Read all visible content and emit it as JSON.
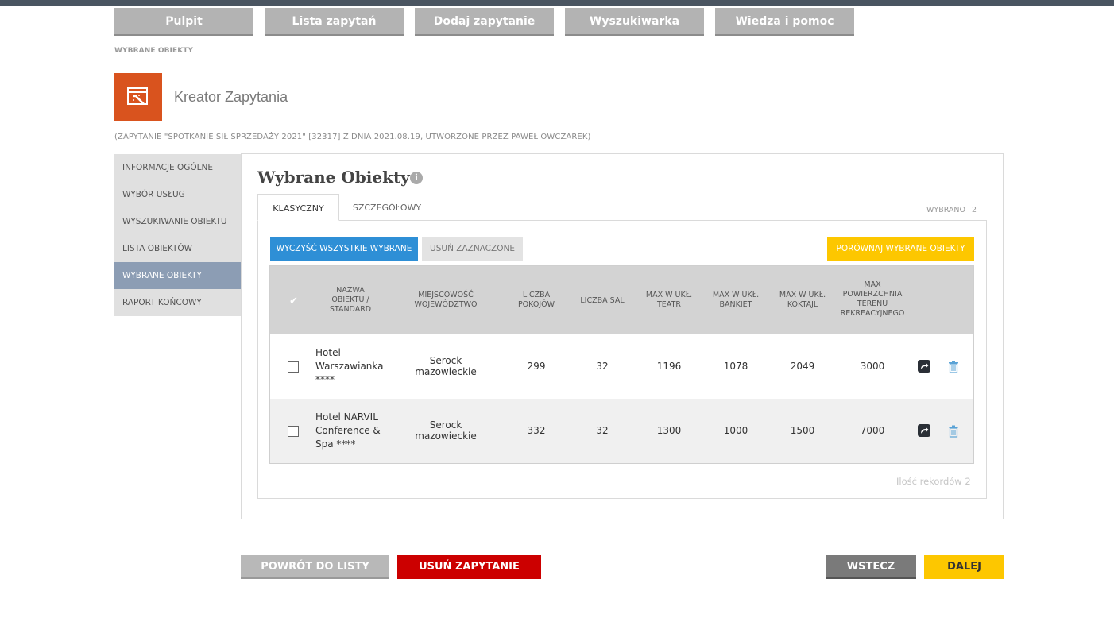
{
  "nav": [
    "Pulpit",
    "Lista zapytań",
    "Dodaj zapytanie",
    "Wyszukiwarka",
    "Wiedza i pomoc"
  ],
  "breadcrumb": "WYBRANE OBIEKTY",
  "page_title": "Kreator Zapytania",
  "subtitle": "(ZAPYTANIE \"SPOTKANIE SIŁ SPRZEDAŻY 2021\" [32317] Z DNIA 2021.08.19, UTWORZONE PRZEZ PAWEŁ OWCZAREK)",
  "sidebar": [
    {
      "label": "INFORMACJE OGÓLNE",
      "active": false
    },
    {
      "label": "WYBÓR USŁUG",
      "active": false
    },
    {
      "label": "WYSZUKIWANIE OBIEKTU",
      "active": false
    },
    {
      "label": "LISTA OBIEKTÓW",
      "active": false
    },
    {
      "label": "WYBRANE OBIEKTY",
      "active": true
    },
    {
      "label": "RAPORT KOŃCOWY",
      "active": false
    }
  ],
  "section_title": "Wybrane Obiekty",
  "tabs": {
    "classic": "KLASYCZNY",
    "detailed": "SZCZEGÓŁOWY"
  },
  "selected": {
    "label": "WYBRANO",
    "count": "2"
  },
  "buttons": {
    "clear_all": "WYCZYŚĆ WSZYSTKIE WYBRANE",
    "remove_selected": "USUŃ ZAZNACZONE",
    "compare": "PORÓWNAJ WYBRANE OBIEKTY"
  },
  "table": {
    "headers": {
      "name": "NAZWA\nOBIEKTU /\nSTANDARD",
      "location": "MIEJSCOWOŚĆ\nWOJEWÓDZTWO",
      "rooms": "LICZBA\nPOKOJÓW",
      "halls": "LICZBA SAL",
      "theatre": "MAX W UKŁ.\nTEATR",
      "banquet": "MAX W UKŁ.\nBANKIET",
      "cocktail": "MAX W UKŁ.\nKOKTAJL",
      "area": "MAX\nPOWIERZCHNIA\nTERENU\nREKREACYJNEGO"
    },
    "rows": [
      {
        "name": "Hotel\nWarszawianka\n****",
        "city": "Serock",
        "region": "mazowieckie",
        "rooms": "299",
        "halls": "32",
        "theatre": "1196",
        "banquet": "1078",
        "cocktail": "2049",
        "area": "3000"
      },
      {
        "name": "Hotel NARVIL\nConference &\nSpa ****",
        "city": "Serock",
        "region": "mazowieckie",
        "rooms": "332",
        "halls": "32",
        "theatre": "1300",
        "banquet": "1000",
        "cocktail": "1500",
        "area": "7000"
      }
    ]
  },
  "records": "Ilość rekordów 2",
  "bottom": {
    "back_to_list": "POWRÓT DO LISTY",
    "delete": "USUŃ ZAPYTANIE",
    "prev": "WSTECZ",
    "next": "DALEJ"
  },
  "colors": {
    "accent_orange": "#d9531e",
    "blue": "#2e8fd6",
    "yellow": "#fdc700",
    "red": "#cc0000",
    "active_side": "#8c9db4"
  }
}
